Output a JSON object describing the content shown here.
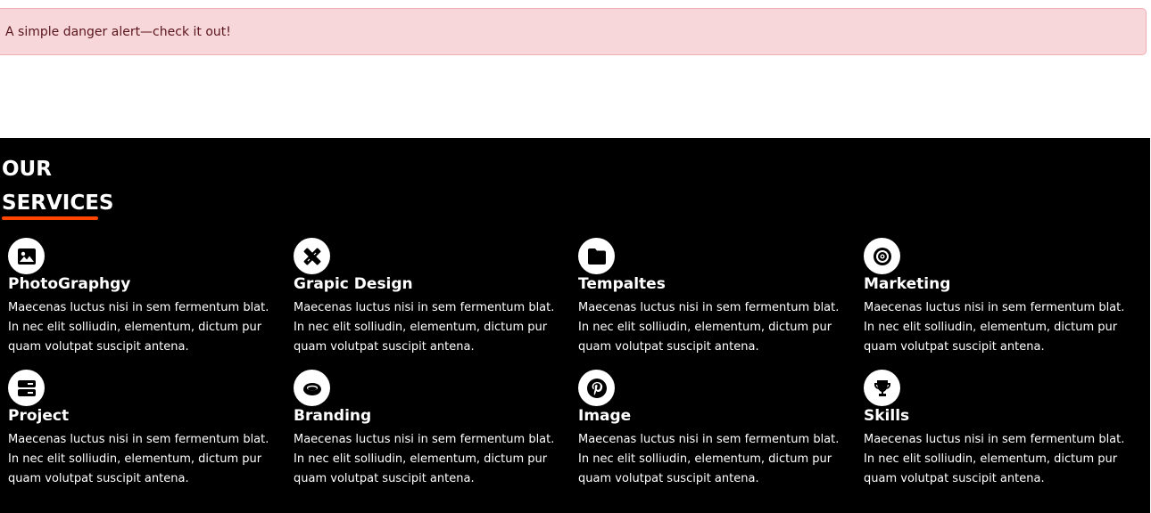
{
  "alert": {
    "text": "A simple danger alert—check it out!"
  },
  "services": {
    "title_line1": "OUR",
    "title_line2": "SERVICES",
    "accent_color": "#ff4500",
    "items": [
      {
        "name": "PhotoGraphgy",
        "icon": "image-icon",
        "desc": "Maecenas luctus nisi in sem fermentum blat. In nec elit solliudin, elementum, dictum pur quam volutpat suscipit antena."
      },
      {
        "name": "Grapic Design",
        "icon": "pencil-ruler-icon",
        "desc": "Maecenas luctus nisi in sem fermentum blat. In nec elit solliudin, elementum, dictum pur quam volutpat suscipit antena."
      },
      {
        "name": "Tempaltes",
        "icon": "folder-icon",
        "desc": "Maecenas luctus nisi in sem fermentum blat. In nec elit solliudin, elementum, dictum pur quam volutpat suscipit antena."
      },
      {
        "name": "Marketing",
        "icon": "target-icon",
        "desc": "Maecenas luctus nisi in sem fermentum blat. In nec elit solliudin, elementum, dictum pur quam volutpat suscipit antena."
      },
      {
        "name": "Project",
        "icon": "server-icon",
        "desc": "Maecenas luctus nisi in sem fermentum blat. In nec elit solliudin, elementum, dictum pur quam volutpat suscipit antena."
      },
      {
        "name": "Branding",
        "icon": "ring-icon",
        "desc": "Maecenas luctus nisi in sem fermentum blat. In nec elit solliudin, elementum, dictum pur quam volutpat suscipit antena."
      },
      {
        "name": "Image",
        "icon": "pinterest-icon",
        "desc": "Maecenas luctus nisi in sem fermentum blat. In nec elit solliudin, elementum, dictum pur quam volutpat suscipit antena."
      },
      {
        "name": "Skills",
        "icon": "trophy-icon",
        "desc": "Maecenas luctus nisi in sem fermentum blat. In nec elit solliudin, elementum, dictum pur quam volutpat suscipit antena."
      }
    ]
  }
}
